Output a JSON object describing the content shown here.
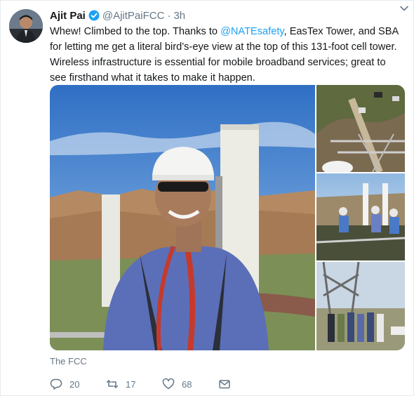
{
  "tweet": {
    "author_name": "Ajit Pai",
    "handle": "@AjitPaiFCC",
    "separator": "·",
    "time": "3h",
    "text_parts": [
      {
        "t": "Whew! Climbed to the top. Thanks to ",
        "mention": false
      },
      {
        "t": "@NATEsafety",
        "mention": true
      },
      {
        "t": ", EasTex Tower, and SBA for letting me get a literal bird’s-eye view at the top of this 131-foot cell tower. Wireless infrastructure is essential for mobile broadband services; great to see firsthand what it takes to make it happen.",
        "mention": false
      }
    ],
    "media_caption": "The FCC",
    "actions": {
      "replies": "20",
      "retweets": "17",
      "likes": "68"
    }
  },
  "colors": {
    "accent": "#1da1f2",
    "text_primary": "#14171a",
    "text_secondary": "#657786"
  },
  "icons": [
    "verified-badge-icon",
    "caret-down-icon",
    "reply-icon",
    "retweet-icon",
    "like-heart-icon",
    "message-envelope-icon"
  ]
}
